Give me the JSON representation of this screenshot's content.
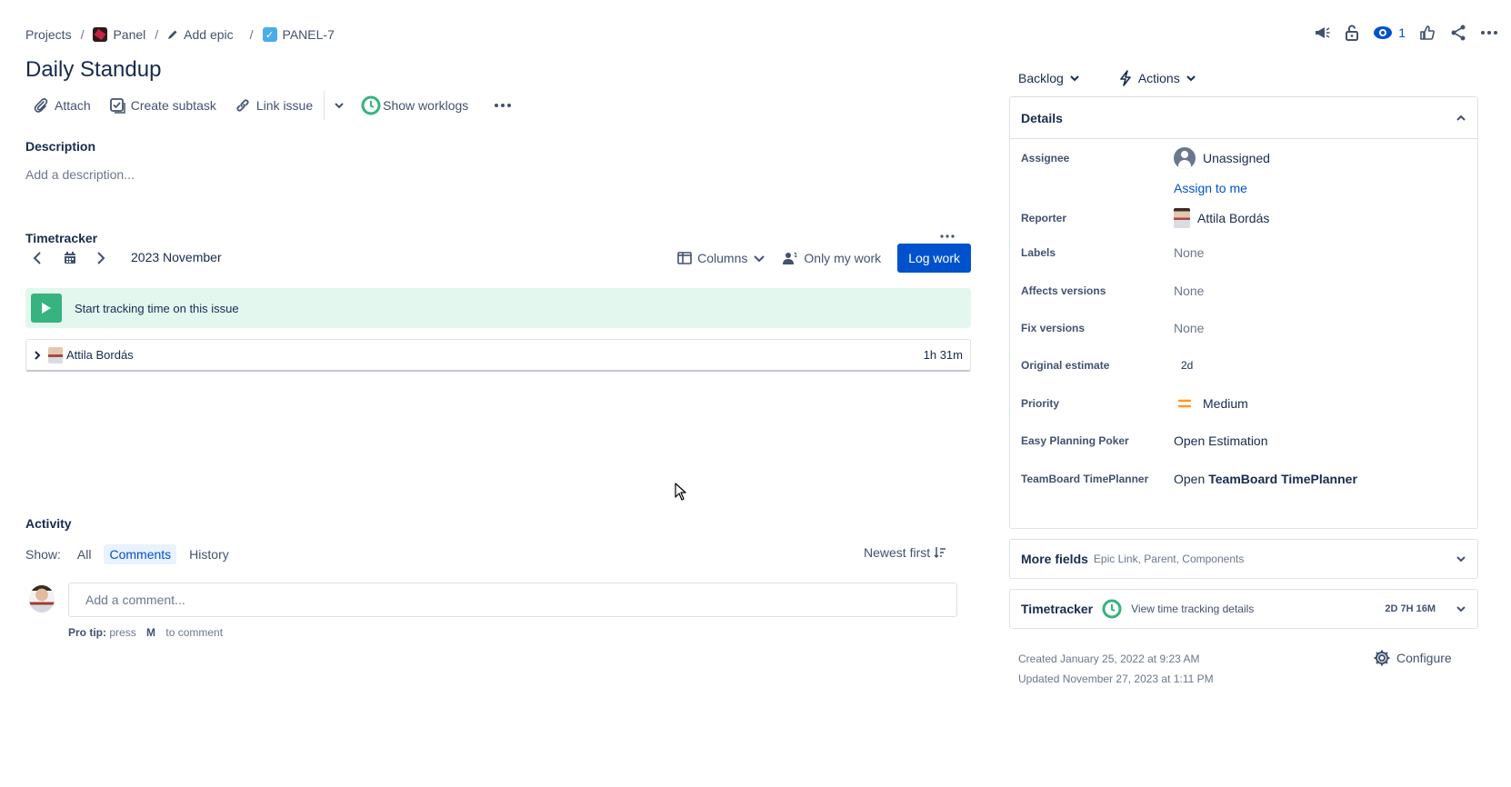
{
  "breadcrumb": {
    "projects": "Projects",
    "project": "Panel",
    "epic": "Add epic",
    "issue_key": "PANEL-7"
  },
  "header": {
    "watchers_count": "1",
    "title": "Daily Standup"
  },
  "toolbar": {
    "attach": "Attach",
    "create_subtask": "Create subtask",
    "link_issue": "Link issue",
    "show_worklogs": "Show worklogs"
  },
  "description": {
    "label": "Description",
    "placeholder": "Add a description..."
  },
  "timetracker": {
    "label": "Timetracker",
    "month": "2023 November",
    "columns": "Columns",
    "only_my_work": "Only my work",
    "log_work": "Log work",
    "start_tracking": "Start tracking time on this issue",
    "rows": [
      {
        "user": "Attila Bordás",
        "duration": "1h 31m"
      }
    ]
  },
  "activity": {
    "label": "Activity",
    "show": "Show:",
    "tabs": [
      "All",
      "Comments",
      "History"
    ],
    "active_tab": "Comments",
    "sort": "Newest first",
    "comment_placeholder": "Add a comment...",
    "tip_prefix": "Pro tip:",
    "tip_press": "press",
    "tip_key": "M",
    "tip_suffix": "to comment"
  },
  "status": {
    "status_label": "Backlog",
    "actions_label": "Actions"
  },
  "details": {
    "header": "Details",
    "assignee_label": "Assignee",
    "assignee_value": "Unassigned",
    "assign_to_me": "Assign to me",
    "reporter_label": "Reporter",
    "reporter_value": "Attila Bordás",
    "labels_label": "Labels",
    "labels_value": "None",
    "affects_label": "Affects versions",
    "affects_value": "None",
    "fix_label": "Fix versions",
    "fix_value": "None",
    "estimate_label": "Original estimate",
    "estimate_value": "2d",
    "priority_label": "Priority",
    "priority_value": "Medium",
    "poker_label": "Easy Planning Poker",
    "poker_value": "Open Estimation",
    "teamboard_label": "TeamBoard TimePlanner",
    "teamboard_prefix": "Open",
    "teamboard_value": "TeamBoard TimePlanner"
  },
  "more_fields": {
    "title": "More fields",
    "subtitle": "Epic Link, Parent, Components"
  },
  "timetracker_panel": {
    "title": "Timetracker",
    "link": "View time tracking details",
    "total": "2D 7H 16M"
  },
  "meta": {
    "created": "Created January 25, 2022 at 9:23 AM",
    "updated": "Updated November 27, 2023 at 1:11 PM",
    "configure": "Configure"
  },
  "colors": {
    "brand_blue": "#0052cc",
    "tracking_bg": "#e3f7ef",
    "play_green": "#36b37e",
    "priority_orange": "#ff991f"
  }
}
